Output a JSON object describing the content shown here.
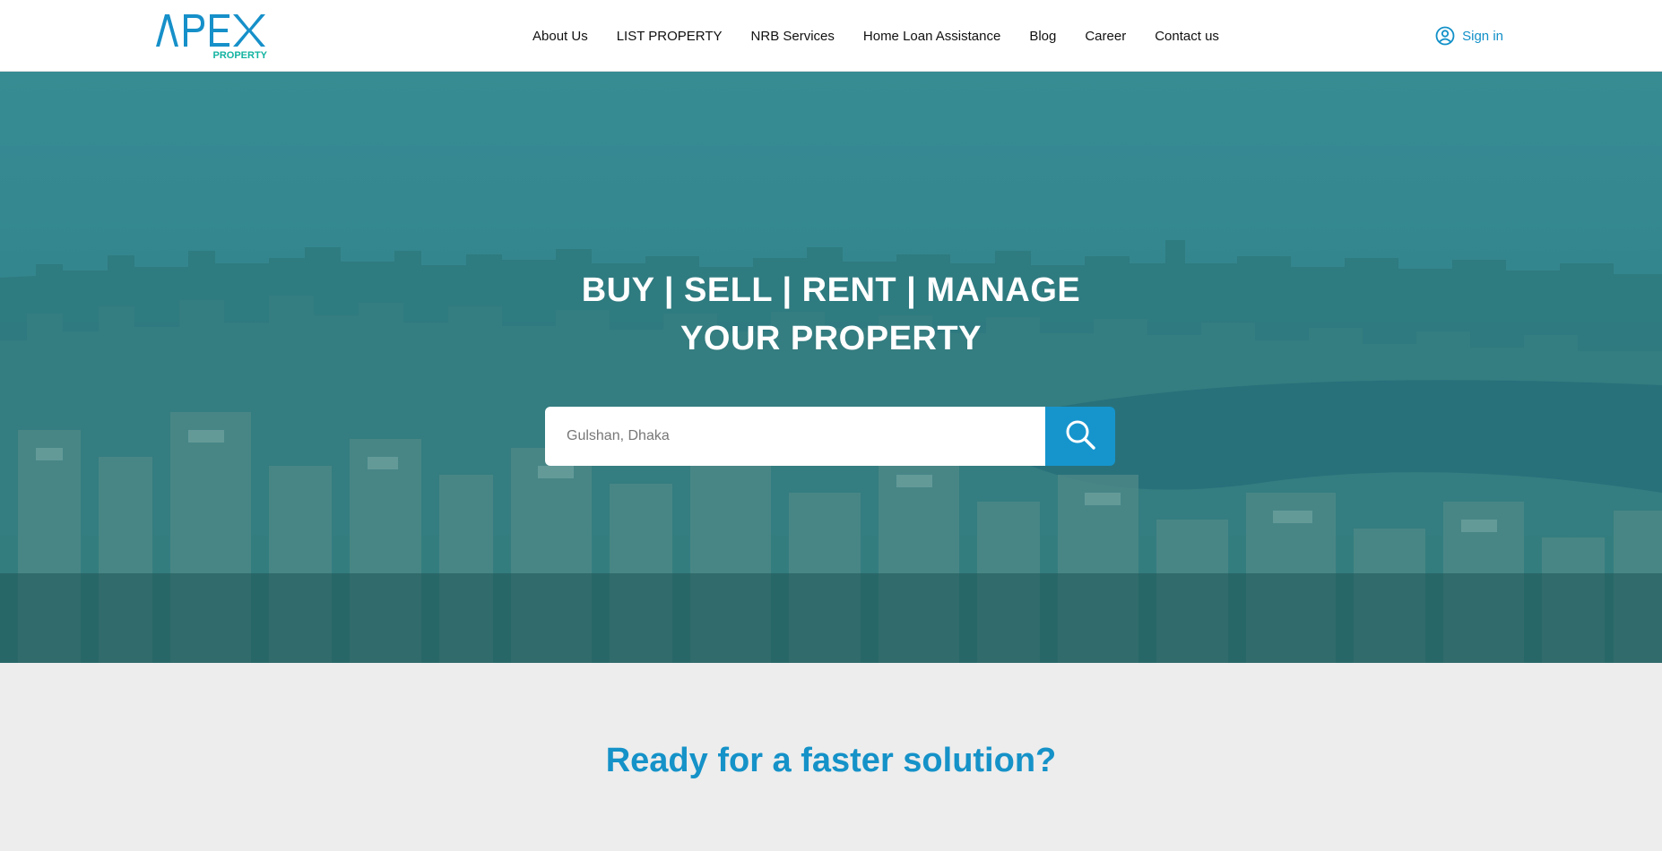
{
  "brand": {
    "logo_text": "APEX",
    "logo_subtext": "PROPERTY",
    "primary_color": "#1690c9",
    "secondary_color": "#12b3a0"
  },
  "nav": {
    "items": [
      {
        "label": "About Us"
      },
      {
        "label": "LIST PROPERTY"
      },
      {
        "label": "NRB Services"
      },
      {
        "label": "Home Loan Assistance"
      },
      {
        "label": "Blog"
      },
      {
        "label": "Career"
      },
      {
        "label": "Contact us"
      }
    ],
    "signin_label": "Sign in",
    "signin_icon": "user-circle-icon"
  },
  "hero": {
    "title_line1": "BUY | SELL | RENT | MANAGE",
    "title_line2": "YOUR PROPERTY",
    "search_placeholder": "Gulshan, Dhaka",
    "search_value": "",
    "search_icon": "search-icon"
  },
  "section": {
    "heading": "Ready for a faster solution?"
  }
}
